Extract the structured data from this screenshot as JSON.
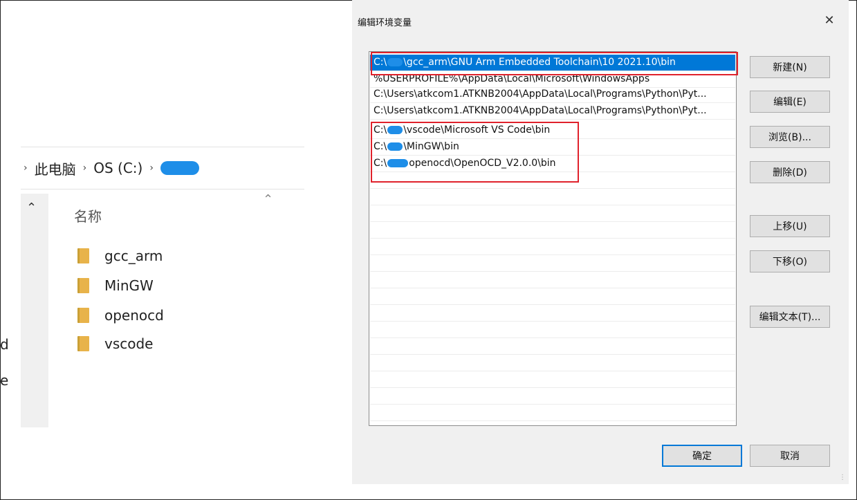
{
  "explorer": {
    "breadcrumb": [
      "此电脑",
      "OS (C:)"
    ],
    "column_header": "名称",
    "folders": [
      "gcc_arm",
      "MinGW",
      "openocd",
      "vscode"
    ],
    "partial_left_text": [
      "d",
      "e"
    ]
  },
  "dialog": {
    "title": "编辑环境变量",
    "paths": [
      {
        "pre": "C:\\",
        "post": "\\gcc_arm\\GNU Arm Embedded Toolchain\\10 2021.10\\bin"
      },
      {
        "pre": "%USERPROFILE%\\AppData\\Local\\Microsoft\\WindowsApps",
        "post": ""
      },
      {
        "pre": "C:\\Users\\atkcom1.ATKNB2004\\AppData\\Local\\Programs\\Python\\Pyt...",
        "post": ""
      },
      {
        "pre": "C:\\Users\\atkcom1.ATKNB2004\\AppData\\Local\\Programs\\Python\\Pyt...",
        "post": ""
      },
      {
        "pre": "C:\\",
        "post": "\\vscode\\Microsoft VS Code\\bin"
      },
      {
        "pre": "C:\\",
        "post": "\\MinGW\\bin"
      },
      {
        "pre": "C:\\",
        "post": "openocd\\OpenOCD_V2.0.0\\bin"
      }
    ],
    "buttons": {
      "new": "新建(N)",
      "edit": "编辑(E)",
      "browse": "浏览(B)...",
      "delete": "删除(D)",
      "move_up": "上移(U)",
      "move_down": "下移(O)",
      "edit_text": "编辑文本(T)...",
      "ok": "确定",
      "cancel": "取消"
    },
    "selected_color": "#0078d7",
    "highlight_color": "#e0212b"
  }
}
